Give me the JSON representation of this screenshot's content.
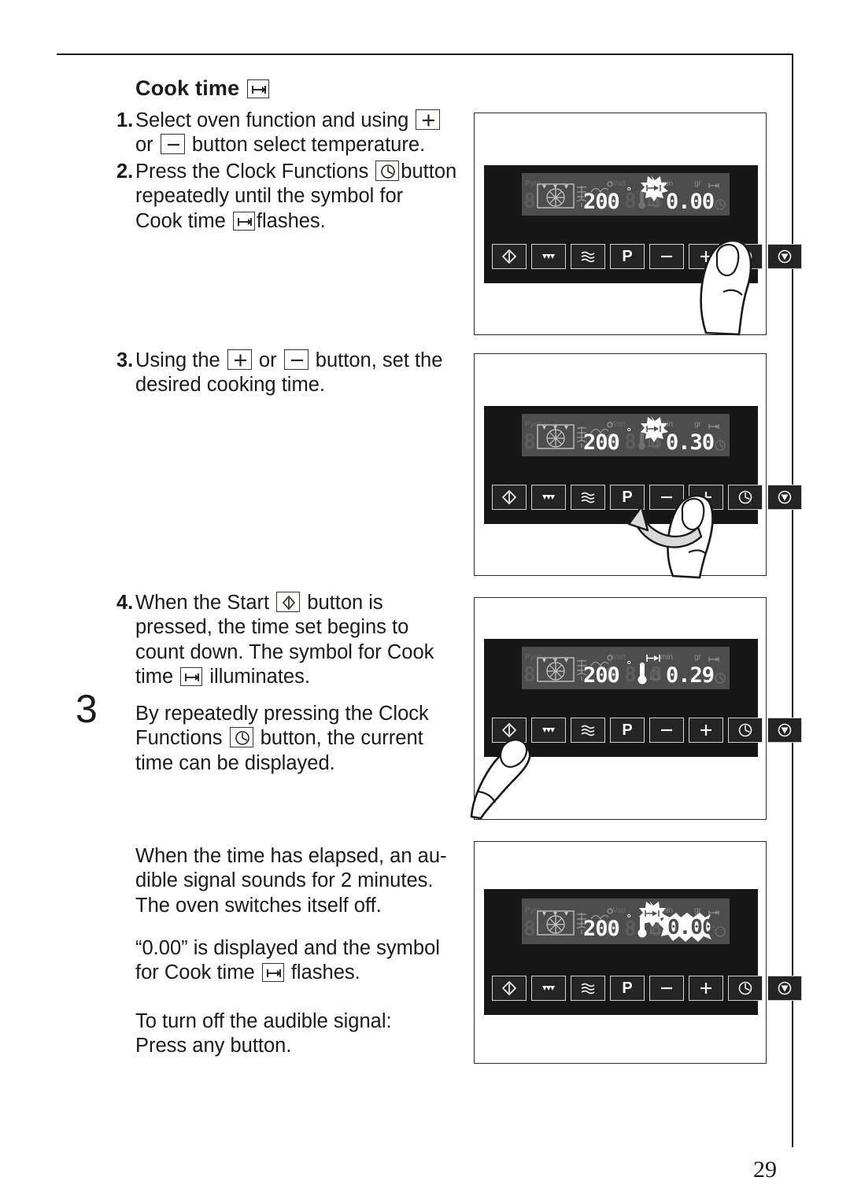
{
  "page": {
    "number": "29",
    "chapter_number": "3"
  },
  "heading": {
    "title": "Cook time",
    "icon": "cook-time-icon"
  },
  "steps": [
    {
      "number": "1.",
      "text_parts": [
        "Select oven function and using ",
        "+",
        " or ",
        "–",
        " button select temperature."
      ],
      "line1_a": "Select oven function and using",
      "line2_a": "or",
      "line2_b": "button select temperature.",
      "icons": [
        "plus-icon",
        "minus-icon"
      ]
    },
    {
      "number": "2.",
      "line1_a": "Press the Clock Functions",
      "line1_b": "button",
      "line2": "repeatedly until the symbol for",
      "line3_a": "Cook time",
      "line3_b": "flashes.",
      "icons": [
        "clock-icon",
        "cook-time-icon"
      ]
    },
    {
      "number": "3.",
      "line1_a": "Using the",
      "line1_b": "or",
      "line1_c": "button, set the",
      "line2": "desired cooking time.",
      "icons": [
        "plus-icon",
        "minus-icon"
      ]
    },
    {
      "number": "4.",
      "line1_a": "When the Start",
      "line1_b": "button is",
      "line2": "pressed, the time set begins to",
      "line3": "count down. The symbol for Cook",
      "line4_a": "time",
      "line4_b": "illuminates.",
      "icons": [
        "start-icon",
        "cook-time-icon"
      ]
    }
  ],
  "paragraphs": {
    "clock_note": {
      "line1": "By repeatedly pressing the Clock",
      "line2_a": "Functions",
      "line2_b": "button, the current",
      "line3": "time can be displayed.",
      "icon": "clock-icon"
    },
    "elapsed": {
      "line1": "When the time has elapsed, an au-",
      "line2": "dible signal sounds for 2 minutes.",
      "line3": "The oven switches itself off."
    },
    "zero_display": {
      "line1": "“0.00” is displayed and the symbol",
      "line2_a": "for Cook time",
      "line2_b": "flashes.",
      "icon": "cook-time-icon"
    },
    "turn_off": {
      "line1": "To turn off the audible signal:",
      "line2": "Press any button."
    }
  },
  "control_panel": {
    "buttons": [
      {
        "name": "start-button",
        "icon": "start-diamond-icon",
        "label": ""
      },
      {
        "name": "grill-button",
        "icon": "grill-icon",
        "label": ""
      },
      {
        "name": "steam-button",
        "icon": "waves-icon",
        "label": ""
      },
      {
        "name": "pyrolysis-button",
        "icon": "p-letter",
        "label": "P"
      },
      {
        "name": "minus-button",
        "icon": "minus-icon",
        "label": "–"
      },
      {
        "name": "plus-button",
        "icon": "plus-icon",
        "label": "+"
      },
      {
        "name": "clock-functions-button",
        "icon": "clock-icon",
        "label": ""
      },
      {
        "name": "stop-button",
        "icon": "stop-triangle-icon",
        "label": ""
      }
    ],
    "lcd_labels": {
      "pyro": "Pyro",
      "watt": "Watt",
      "min": "min",
      "gr": "gr"
    }
  },
  "panels": [
    {
      "name": "panel-step2",
      "display": {
        "temperature": "200",
        "degree": "°",
        "time": "0.00",
        "cook_time_symbol_state": "flashing",
        "thermometer_lit": false,
        "pressed_button": "clock-functions-button"
      }
    },
    {
      "name": "panel-step3",
      "display": {
        "temperature": "200",
        "degree": "°",
        "time": "0.30",
        "cook_time_symbol_state": "flashing",
        "thermometer_lit": false,
        "pressed_button": "plus-button"
      }
    },
    {
      "name": "panel-step4",
      "display": {
        "temperature": "200",
        "degree": "°",
        "time": "0.29",
        "cook_time_symbol_state": "steady",
        "thermometer_lit": true,
        "pressed_button": "start-button"
      }
    },
    {
      "name": "panel-finished",
      "display": {
        "temperature": "200",
        "degree": "°",
        "time": "0.00",
        "cook_time_symbol_state": "flashing",
        "time_flashing": true,
        "thermometer_lit": true,
        "pressed_button": ""
      }
    }
  ],
  "colors": {
    "panel_background": "#171717",
    "lcd_background": "#4d4d4d",
    "lcd_active": "#ffffff",
    "lcd_inactive": "#5f5f5f",
    "text": "#1a1a1a"
  }
}
